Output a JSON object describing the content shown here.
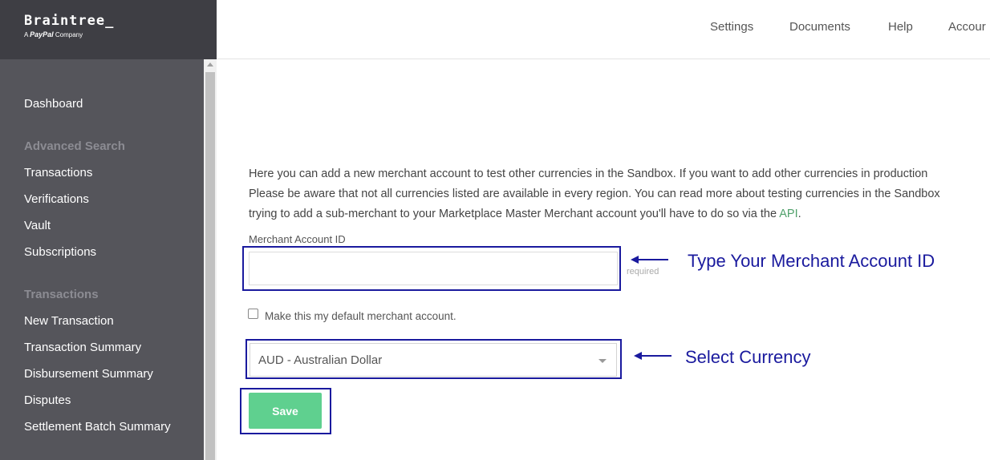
{
  "brand": {
    "name": "Braintree_",
    "sub_prefix": "A ",
    "sub_paypal": "PayPal",
    "sub_suffix": " Company"
  },
  "topnav": {
    "items": [
      "Settings",
      "Documents",
      "Help",
      "Accour"
    ]
  },
  "sidebar": {
    "dashboard": "Dashboard",
    "advanced_search_heading": "Advanced Search",
    "advanced_search_items": [
      "Transactions",
      "Verifications",
      "Vault",
      "Subscriptions"
    ],
    "transactions_heading": "Transactions",
    "transactions_items": [
      "New Transaction",
      "Transaction Summary",
      "Disbursement Summary",
      "Disputes",
      "Settlement Batch Summary"
    ]
  },
  "content": {
    "intro_line1": "Here you can add a new merchant account to test other currencies in the Sandbox. If you want to add other currencies in production",
    "intro_line2": "Please be aware that not all currencies listed are available in every region. You can read more about testing currencies in the Sandbox",
    "intro_line3_pre": "trying to add a sub-merchant to your Marketplace Master Merchant account you'll have to do so via the ",
    "intro_line3_link": "API",
    "intro_line3_post": ".",
    "merchant_id_label": "Merchant Account ID",
    "merchant_id_value": "",
    "merchant_id_hint": "required",
    "default_checkbox_label": "Make this my default merchant account.",
    "default_checked": false,
    "currency_selected": "AUD - Australian Dollar",
    "save_label": "Save"
  },
  "annotations": {
    "merchant_id_note": "Type Your Merchant Account ID",
    "currency_note": "Select Currency"
  },
  "colors": {
    "sidebar_bg": "#55555b",
    "logo_bg": "#3e3e44",
    "save_button": "#5fd08f",
    "annotation": "#1a1a9e",
    "link": "#4fa06a"
  }
}
